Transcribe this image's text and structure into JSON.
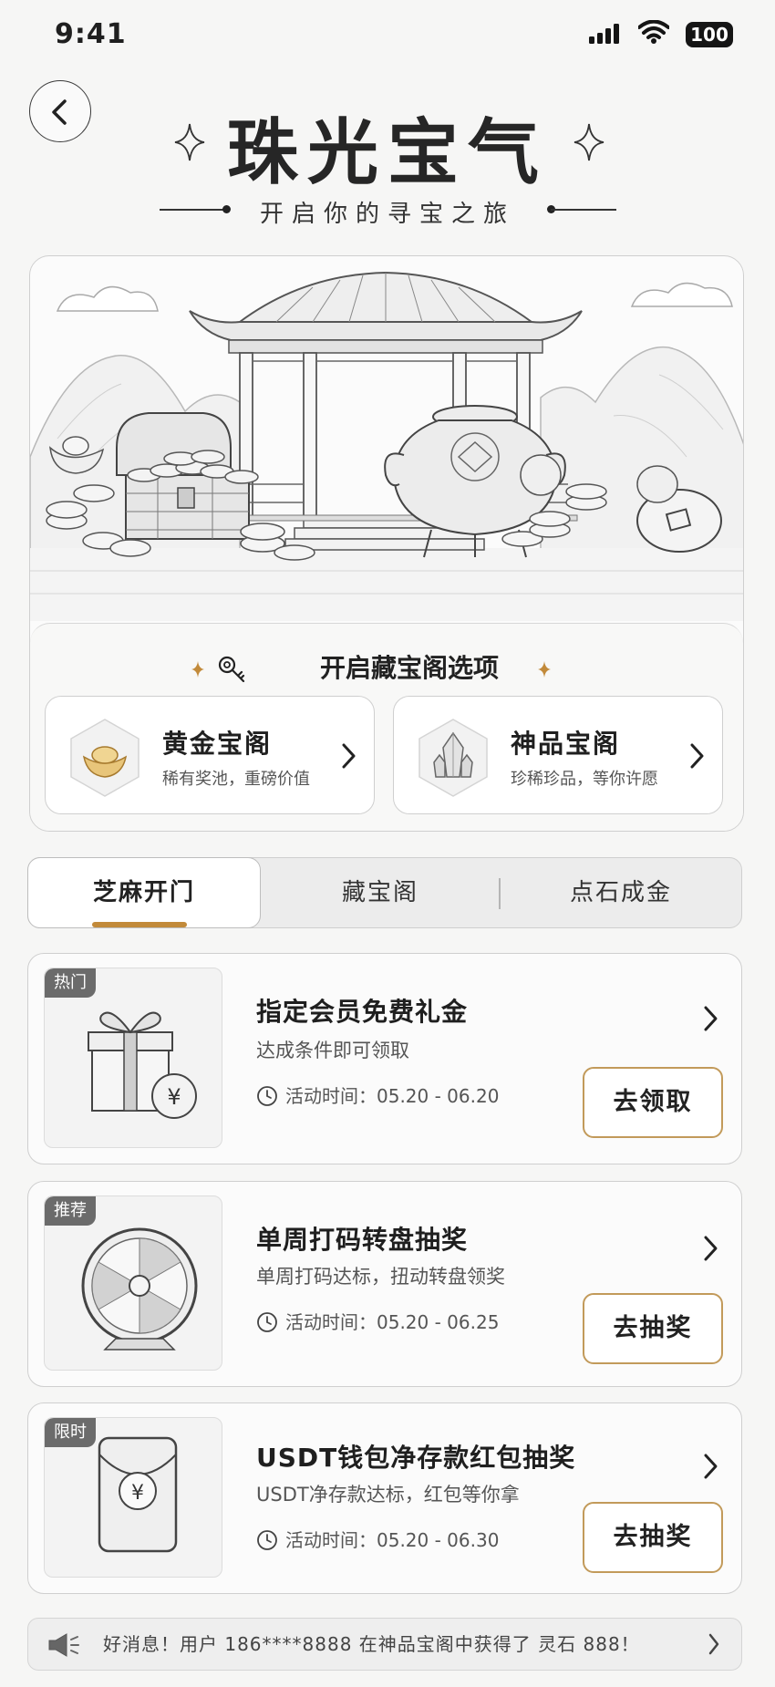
{
  "status_bar": {
    "time": "9:41",
    "battery": "100"
  },
  "header": {
    "title": "珠光宝气",
    "subtitle": "开启你的寻宝之旅"
  },
  "options": {
    "title": "开启藏宝阁选项",
    "items": [
      {
        "name": "黄金宝阁",
        "desc": "稀有奖池，重磅价值",
        "icon": "gold-ingot-icon"
      },
      {
        "name": "神品宝阁",
        "desc": "珍稀珍品，等你许愿",
        "icon": "crystal-icon"
      }
    ]
  },
  "tabs": [
    "芝麻开门",
    "藏宝阁",
    "点石成金"
  ],
  "activities": [
    {
      "badge": "热门",
      "title": "指定会员免费礼金",
      "desc": "达成条件即可领取",
      "time": "活动时间：05.20 - 06.20",
      "button": "去领取",
      "icon": "gift-box-icon"
    },
    {
      "badge": "推荐",
      "title": "单周打码转盘抽奖",
      "desc": "单周打码达标，扭动转盘领奖",
      "time": "活动时间：05.20 - 06.25",
      "button": "去抽奖",
      "icon": "prize-wheel-icon"
    },
    {
      "badge": "限时",
      "title": "USDT钱包净存款红包抽奖",
      "desc": "USDT净存款达标，红包等你拿",
      "time": "活动时间：05.20 - 06.30",
      "button": "去抽奖",
      "icon": "red-envelope-icon"
    }
  ],
  "ticker": {
    "message": "好消息！用户 186****8888 在神品宝阁中获得了 灵石 888！"
  },
  "colors": {
    "accent": "#c28a3a",
    "button_border": "#c29a5a",
    "badge": "#6b6b6b"
  }
}
